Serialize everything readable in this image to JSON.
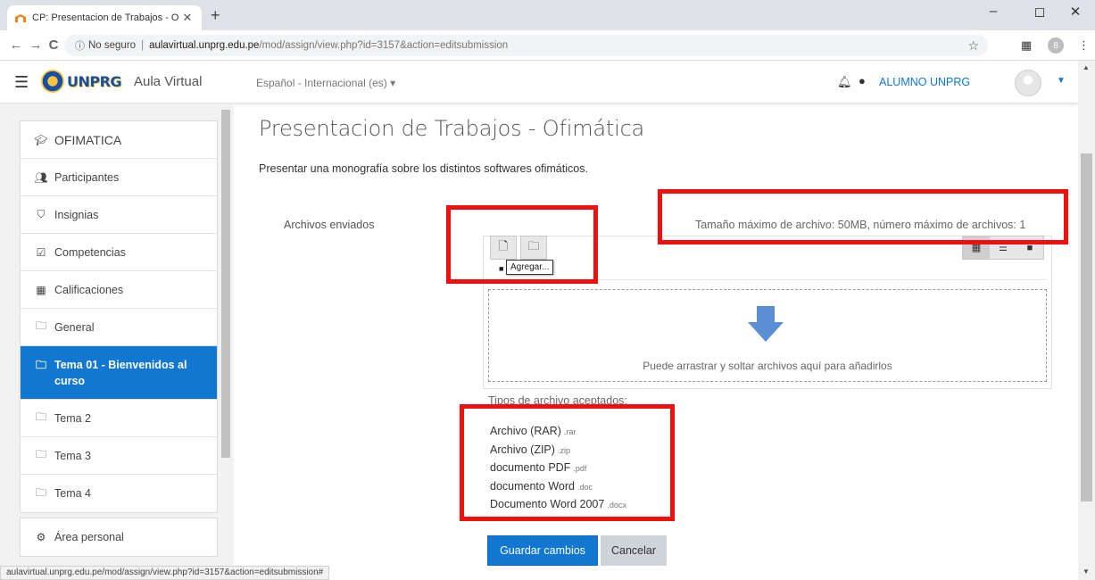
{
  "browser": {
    "tab_title": "CP: Presentacion de Trabajos - O",
    "tab_close": "✕",
    "new_tab": "+",
    "window_controls": [
      "–",
      "◻",
      "✕"
    ],
    "nav": {
      "back": "←",
      "forward": "→",
      "reload": "C"
    },
    "security_label": "No seguro",
    "url_host": "aulavirtual.unprg.edu.pe",
    "url_path": "/mod/assign/view.php?id=3157&action=editsubmission",
    "profile_initial": "8"
  },
  "navbar": {
    "logo_text": "UNPRG",
    "site_name": "Aula Virtual",
    "language": "Español - Internacional (es) ▾",
    "username": "ALUMNO UNPRG",
    "caret": "▼"
  },
  "drawer": {
    "course": "OFIMATICA",
    "items": [
      {
        "label": "Participantes",
        "icon": "users-icon"
      },
      {
        "label": "Insignias",
        "icon": "shield-icon"
      },
      {
        "label": "Competencias",
        "icon": "checkbox-icon"
      },
      {
        "label": "Calificaciones",
        "icon": "table-icon"
      },
      {
        "label": "General",
        "icon": "folder-icon"
      },
      {
        "label": "Tema 01 - Bienvenidos al curso",
        "icon": "folder-icon",
        "active": true
      },
      {
        "label": "Tema 2",
        "icon": "folder-icon"
      },
      {
        "label": "Tema 3",
        "icon": "folder-icon"
      },
      {
        "label": "Tema 4",
        "icon": "folder-icon"
      }
    ],
    "personal_area": "Área personal"
  },
  "main": {
    "title": "Presentacion de Trabajos - Ofimática",
    "intro": "Presentar una monografía sobre los distintos softwares ofimáticos.",
    "field_label": "Archivos enviados",
    "max_info": "Tamaño máximo de archivo: 50MB, número máximo de archivos: 1",
    "tooltip": "Agregar...",
    "drop_text": "Puede arrastrar y soltar archivos aquí para añadirlos",
    "types_heading": "Tipos de archivo aceptados:",
    "file_types": [
      {
        "name": "Archivo (RAR)",
        "ext": ".rar"
      },
      {
        "name": "Archivo (ZIP)",
        "ext": ".zip"
      },
      {
        "name": "documento PDF",
        "ext": ".pdf"
      },
      {
        "name": "documento Word",
        "ext": ".doc"
      },
      {
        "name": "Documento Word 2007",
        "ext": ".docx"
      }
    ],
    "save_button": "Guardar cambios",
    "cancel_button": "Cancelar"
  },
  "status_url": "aulavirtual.unprg.edu.pe/mod/assign/view.php?id=3157&action=editsubmission#",
  "colors": {
    "accent": "#1177d1",
    "highlight": "#ee0f0f",
    "drop_arrow": "#5a8fd6"
  }
}
